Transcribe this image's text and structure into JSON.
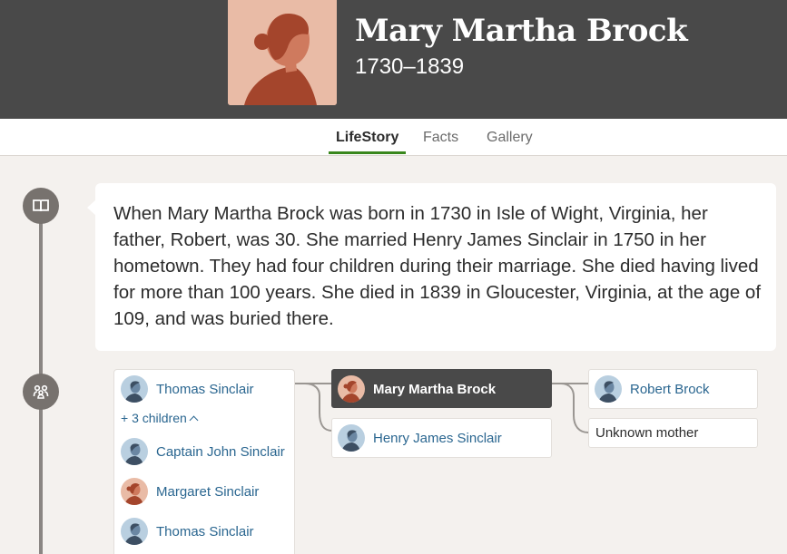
{
  "header": {
    "name": "Mary Martha Brock",
    "years": "1730–1839",
    "portrait": "female-silhouette-portrait"
  },
  "tabs": [
    {
      "label": "LifeStory",
      "active": true
    },
    {
      "label": "Facts",
      "active": false
    },
    {
      "label": "Gallery",
      "active": false
    }
  ],
  "timeline": {
    "icons": [
      "book-icon",
      "family-icon"
    ]
  },
  "story": {
    "text": "When Mary Martha Brock was born in 1730 in Isle of Wight, Virginia, her father, Robert, was 30. She married Henry James Sinclair in 1750 in her hometown. They had four children during their marriage. She died having lived for more than 100 years. She died in 1839 in Gloucester, Virginia, at the age of 109, and was buried there."
  },
  "family": {
    "children": {
      "first": {
        "name": "Thomas Sinclair",
        "gender": "male"
      },
      "more_label": "+ 3 children",
      "more_icon": "chevron-up-icon",
      "others": [
        {
          "name": "Captain John Sinclair",
          "gender": "male"
        },
        {
          "name": "Margaret Sinclair",
          "gender": "female"
        },
        {
          "name": "Thomas Sinclair",
          "gender": "male"
        }
      ]
    },
    "self": {
      "name": "Mary Martha Brock",
      "gender": "female"
    },
    "spouse": {
      "name": "Henry James Sinclair",
      "gender": "male"
    },
    "father": {
      "name": "Robert Brock",
      "gender": "male"
    },
    "mother": {
      "label": "Unknown mother"
    }
  },
  "colors": {
    "header_bg": "#494949",
    "accent_green": "#39871c",
    "link_blue": "#2a6690",
    "male_avatar_bg": "#b9cfe0",
    "female_avatar_bg": "#e9bba6"
  }
}
